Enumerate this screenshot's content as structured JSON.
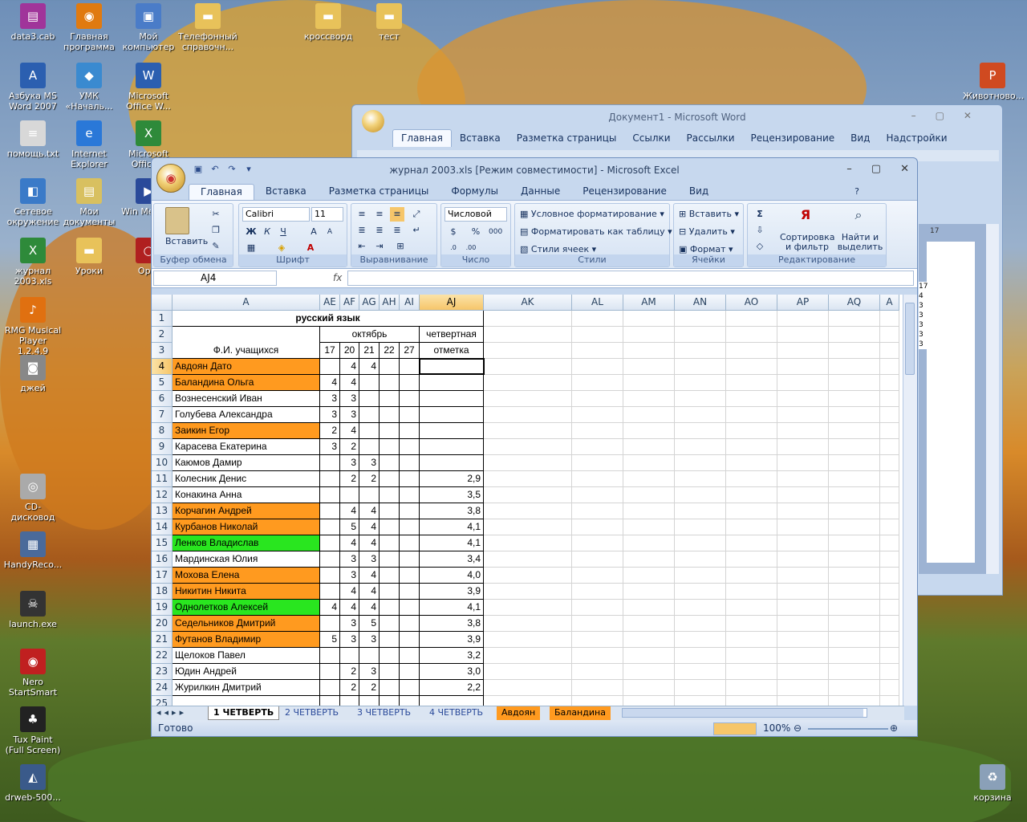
{
  "desktop": {
    "icons": [
      {
        "label": "data3.cab",
        "glyph": "▤",
        "color": "#a0349a"
      },
      {
        "label": "Главная программа",
        "glyph": "◉",
        "color": "#e07a10"
      },
      {
        "label": "Мой компьютер",
        "glyph": "▣",
        "color": "#4a7cc8"
      },
      {
        "label": "Телефонный справочн...",
        "glyph": "▬",
        "color": "#e8c25a"
      },
      {
        "label": "кроссворд",
        "glyph": "▬",
        "color": "#e8c25a"
      },
      {
        "label": "тест",
        "glyph": "▬",
        "color": "#e8c25a"
      },
      {
        "label": "Азбука MS Word 2007",
        "glyph": "A",
        "color": "#2b5fb0"
      },
      {
        "label": "УМК «Началь...",
        "glyph": "◆",
        "color": "#3a8ad0"
      },
      {
        "label": "Microsoft Office W...",
        "glyph": "W",
        "color": "#2b5fb0"
      },
      {
        "label": "помощь.txt",
        "glyph": "≡",
        "color": "#d8d8d8"
      },
      {
        "label": "Internet Explorer",
        "glyph": "e",
        "color": "#2a78d8"
      },
      {
        "label": "Microsoft Office...",
        "glyph": "X",
        "color": "#2e8a3a"
      },
      {
        "label": "Сетевое окружение",
        "glyph": "◧",
        "color": "#3a7ac8"
      },
      {
        "label": "Мои документы",
        "glyph": "▤",
        "color": "#d8c060"
      },
      {
        "label": "Win Media...",
        "glyph": "▶",
        "color": "#2a4a9a"
      },
      {
        "label": "журнал 2003.xls",
        "glyph": "X",
        "color": "#2e8a3a"
      },
      {
        "label": "Уроки",
        "glyph": "▬",
        "color": "#e8c25a"
      },
      {
        "label": "Op...",
        "glyph": "○",
        "color": "#b02020"
      },
      {
        "label": "RMG Musical Player 1.2.4.9",
        "glyph": "♪",
        "color": "#e07010"
      },
      {
        "label": "джей",
        "glyph": "◙",
        "color": "#888888"
      },
      {
        "label": "CD-дисковод",
        "glyph": "◎",
        "color": "#aaaaaa"
      },
      {
        "label": "HandyReco...",
        "glyph": "▦",
        "color": "#4a6a9a"
      },
      {
        "label": "launch.exe",
        "glyph": "☠",
        "color": "#333333"
      },
      {
        "label": "Nero StartSmart",
        "glyph": "◉",
        "color": "#c02020"
      },
      {
        "label": "Tux Paint (Full Screen)",
        "glyph": "♣",
        "color": "#222222"
      },
      {
        "label": "drweb-500...",
        "glyph": "◭",
        "color": "#3a5a8a"
      },
      {
        "label": "Животново...",
        "glyph": "P",
        "color": "#d04a20"
      },
      {
        "label": "корзина",
        "glyph": "♻",
        "color": "#8aa0b8"
      }
    ]
  },
  "word": {
    "title": "Документ1 - Microsoft Word",
    "tabs": [
      "Главная",
      "Вставка",
      "Разметка страницы",
      "Ссылки",
      "Рассылки",
      "Рецензирование",
      "Вид",
      "Надстройки"
    ],
    "ruler_value": "17",
    "side_values": [
      "17",
      "4",
      "3",
      "3",
      "3",
      "3",
      "3"
    ]
  },
  "excel": {
    "title": "журнал 2003.xls  [Режим совместимости] - Microsoft Excel",
    "tabs": [
      "Главная",
      "Вставка",
      "Разметка страницы",
      "Формулы",
      "Данные",
      "Рецензирование",
      "Вид"
    ],
    "ribbon": {
      "clipboard": {
        "paste": "Вставить",
        "label": "Буфер обмена"
      },
      "font": {
        "name": "Calibri",
        "size": "11",
        "label": "Шрифт"
      },
      "alignment": {
        "label": "Выравнивание"
      },
      "number": {
        "format": "Числовой",
        "label": "Число"
      },
      "styles": {
        "cond": "Условное форматирование",
        "table": "Форматировать как таблицу",
        "cell": "Стили ячеек",
        "label": "Стили"
      },
      "cells": {
        "insert": "Вставить",
        "delete": "Удалить",
        "format": "Формат",
        "label": "Ячейки"
      },
      "editing": {
        "sort": "Сортировка и фильтр",
        "find": "Найти и выделить",
        "label": "Редактирование"
      }
    },
    "namebox": "AJ4",
    "fx": "fx",
    "columns": [
      "A",
      "AE",
      "AF",
      "AG",
      "AH",
      "AI",
      "AJ",
      "AK",
      "AL",
      "AM",
      "AN",
      "AO",
      "AP",
      "AQ",
      "A"
    ],
    "title_cell": "русский язык",
    "month": "октябрь",
    "quarter_header_1": "четвертная",
    "quarter_header_2": "отметка",
    "students_header": "Ф.И. учащихся",
    "days": [
      "17",
      "20",
      "21",
      "22",
      "27"
    ],
    "rows": [
      {
        "n": "4",
        "name": " Авдоян Дато",
        "color": "orange",
        "ae": "",
        "af": "4",
        "ag": "4",
        "aj": ""
      },
      {
        "n": "5",
        "name": "Баландина Ольга",
        "color": "orange",
        "ae": "4",
        "af": "4",
        "ag": "",
        "aj": ""
      },
      {
        "n": "6",
        "name": "Вознесенский Иван",
        "color": "",
        "ae": "3",
        "af": "3",
        "ag": "",
        "aj": ""
      },
      {
        "n": "7",
        "name": "Голубева Александра",
        "color": "",
        "ae": "3",
        "af": "3",
        "ag": "",
        "aj": ""
      },
      {
        "n": "8",
        "name": "Заикин Егор",
        "color": "orange",
        "ae": "2",
        "af": "4",
        "ag": "",
        "aj": ""
      },
      {
        "n": "9",
        "name": "Карасева Екатерина",
        "color": "",
        "ae": "3",
        "af": "2",
        "ag": "",
        "aj": ""
      },
      {
        "n": "10",
        "name": "Каюмов Дамир",
        "color": "",
        "ae": "",
        "af": "3",
        "ag": "3",
        "aj": ""
      },
      {
        "n": "11",
        "name": "Колесник Денис",
        "color": "",
        "ae": "",
        "af": "2",
        "ag": "2",
        "aj": "2,9"
      },
      {
        "n": "12",
        "name": "Конакина Анна",
        "color": "",
        "ae": "",
        "af": "",
        "ag": "",
        "aj": "3,5"
      },
      {
        "n": "13",
        "name": "Корчагин Андрей",
        "color": "orange",
        "ae": "",
        "af": "4",
        "ag": "4",
        "aj": "3,8"
      },
      {
        "n": "14",
        "name": "Курбанов Николай",
        "color": "orange",
        "ae": "",
        "af": "5",
        "ag": "4",
        "aj": "4,1"
      },
      {
        "n": "15",
        "name": "Ленков Владислав",
        "color": "green",
        "ae": "",
        "af": "4",
        "ag": "4",
        "aj": "4,1"
      },
      {
        "n": "16",
        "name": "Мардинская Юлия",
        "color": "",
        "ae": "",
        "af": "3",
        "ag": "3",
        "aj": "3,4"
      },
      {
        "n": "17",
        "name": "Мохова Елена",
        "color": "orange",
        "ae": "",
        "af": "3",
        "ag": "4",
        "aj": "4,0"
      },
      {
        "n": "18",
        "name": "Никитин Никита",
        "color": "orange",
        "ae": "",
        "af": "4",
        "ag": "4",
        "aj": "3,9"
      },
      {
        "n": "19",
        "name": "Однолетков Алексей",
        "color": "green",
        "ae": "4",
        "af": "4",
        "ag": "4",
        "aj": "4,1"
      },
      {
        "n": "20",
        "name": "Седельников Дмитрий",
        "color": "orange",
        "ae": "",
        "af": "3",
        "ag": "5",
        "aj": "3,8"
      },
      {
        "n": "21",
        "name": "Футанов Владимир",
        "color": "orange",
        "ae": "5",
        "af": "3",
        "ag": "3",
        "aj": "3,9"
      },
      {
        "n": "22",
        "name": " Щелоков Павел",
        "color": "",
        "ae": "",
        "af": "",
        "ag": "",
        "aj": "3,2"
      },
      {
        "n": "23",
        "name": "Юдин Андрей",
        "color": "",
        "ae": "",
        "af": "2",
        "ag": "3",
        "aj": "3,0"
      },
      {
        "n": "24",
        "name": "Журилкин Дмитрий",
        "color": "",
        "ae": "",
        "af": "2",
        "ag": "2",
        "aj": "2,2"
      },
      {
        "n": "25",
        "name": "",
        "color": "",
        "ae": "",
        "af": "",
        "ag": "",
        "aj": ""
      }
    ],
    "sheets": [
      {
        "label": "1 ЧЕТВЕРТЬ",
        "active": true,
        "orange": false
      },
      {
        "label": "2 ЧЕТВЕРТЬ",
        "active": false,
        "orange": false
      },
      {
        "label": "3 ЧЕТВЕРТЬ",
        "active": false,
        "orange": false
      },
      {
        "label": "4 ЧЕТВЕРТЬ",
        "active": false,
        "orange": false
      },
      {
        "label": "Авдоян",
        "active": false,
        "orange": true
      },
      {
        "label": "Баландина",
        "active": false,
        "orange": true
      }
    ],
    "status": "Готово",
    "zoom": "100%"
  }
}
